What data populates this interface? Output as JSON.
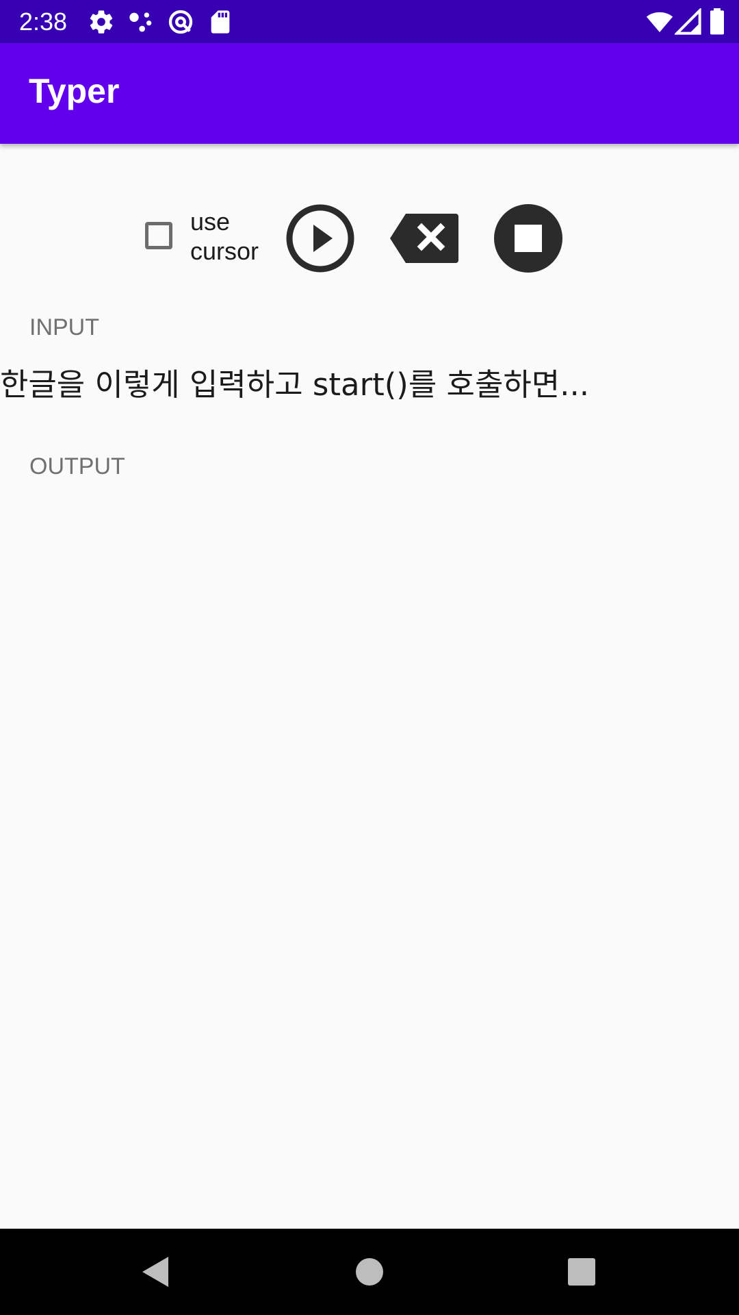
{
  "status_bar": {
    "time": "2:38",
    "icons": [
      "gear-icon",
      "assistant-dots-icon",
      "at-sign-icon",
      "sd-card-icon",
      "wifi-icon",
      "signal-icon",
      "battery-icon"
    ]
  },
  "app_bar": {
    "title": "Typer"
  },
  "controls": {
    "checkbox_label": "use cursor",
    "checkbox_checked": false,
    "buttons": [
      "play-icon",
      "backspace-icon",
      "stop-icon"
    ]
  },
  "input": {
    "label": "INPUT",
    "text": "한글을 이렇게 입력하고 start()를 호출하면..."
  },
  "output": {
    "label": "OUTPUT",
    "text": ""
  },
  "nav_bar": {
    "buttons": [
      "back-icon",
      "home-icon",
      "recents-icon"
    ]
  },
  "colors": {
    "status_bar": "#3700b3",
    "app_bar": "#6200ee",
    "background": "#fafafa",
    "icon_dark": "#2b2b2b"
  }
}
